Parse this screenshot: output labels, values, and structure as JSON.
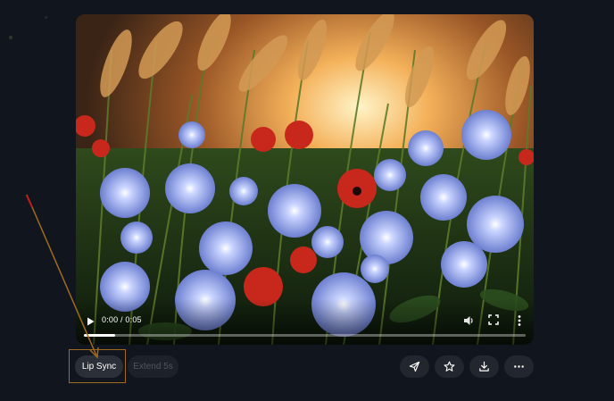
{
  "video": {
    "time_display": "0:00 / 0:05",
    "progress_fraction": 0.0,
    "watermark": "",
    "controls": {
      "play_icon": "play-icon",
      "volume_icon": "volume-icon",
      "fullscreen_icon": "fullscreen-icon",
      "more_icon": "more-vertical-icon"
    }
  },
  "actions": {
    "lip_sync_label": "Lip Sync",
    "extend_label": "Extend 5s",
    "share_icon": "send-icon",
    "favorite_icon": "star-icon",
    "download_icon": "download-icon",
    "more_icon": "more-horizontal-icon"
  },
  "colors": {
    "background": "#11151d",
    "highlight_box": "#a06a1f",
    "annotation_arrow": "#a06a1f",
    "primary_button": "#2b2f37",
    "disabled_button": "#1d2129"
  }
}
